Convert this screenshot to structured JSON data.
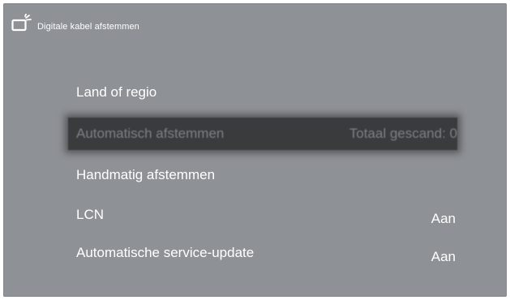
{
  "header": {
    "title": "Digitale kabel afstemmen",
    "icon": "tv-antenna-icon"
  },
  "colors": {
    "background": "#8e9196",
    "text": "#ffffff",
    "selection": "#3a3b3d",
    "selection_text": "#7d7f83"
  },
  "menu": {
    "items": [
      {
        "label": "Land of regio",
        "value": ""
      },
      {
        "label": "Automatisch afstemmen",
        "value": "Totaal gescand: 0",
        "selected": true
      },
      {
        "label": "Handmatig afstemmen",
        "value": ""
      },
      {
        "label": "LCN",
        "value": "Aan"
      },
      {
        "label": "Automatische service-update",
        "value": "Aan"
      }
    ]
  }
}
